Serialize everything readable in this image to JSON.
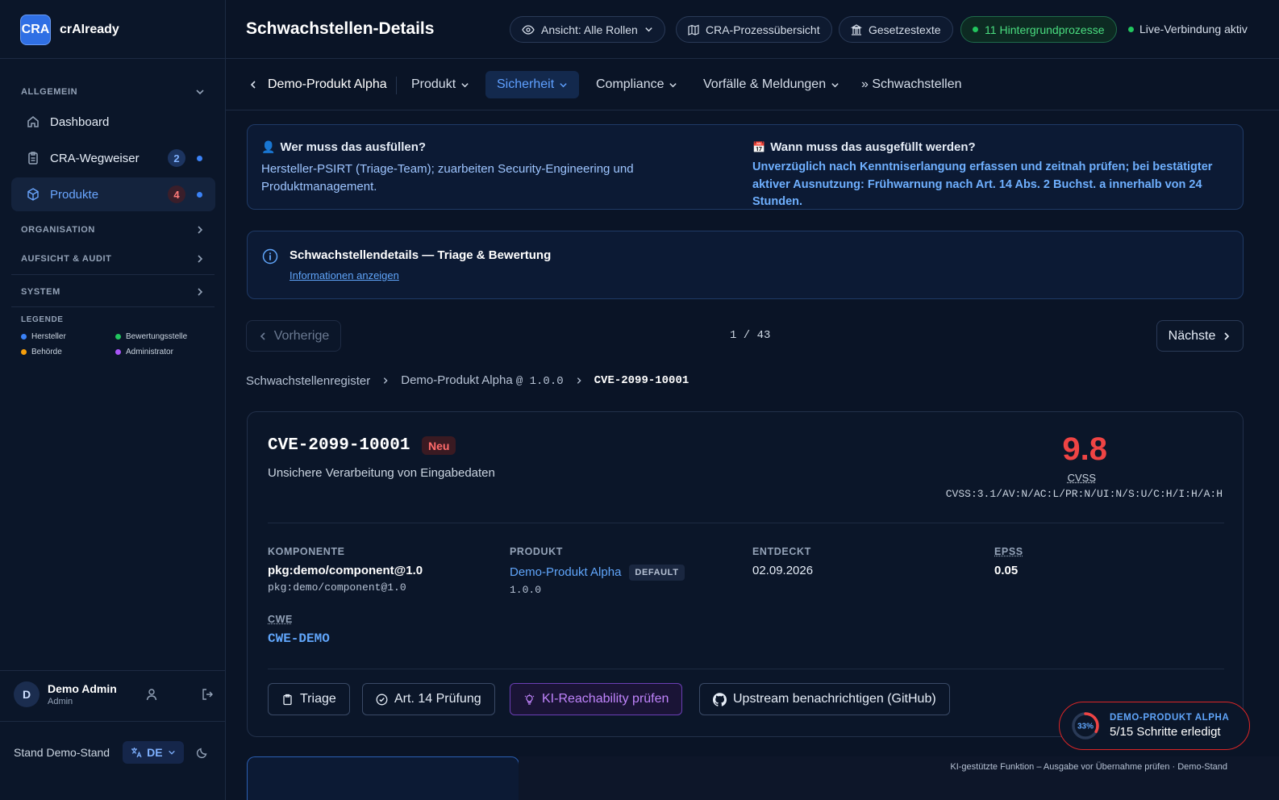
{
  "brand": {
    "logo": "CRA",
    "name": "crAIready"
  },
  "sidebar": {
    "sections": {
      "allgemein": "ALLGEMEIN",
      "organisation": "ORGANISATION",
      "aufsicht": "AUFSICHT & AUDIT",
      "system": "SYSTEM"
    },
    "items": [
      {
        "label": "Dashboard",
        "icon": "home-icon"
      },
      {
        "label": "CRA-Wegweiser",
        "icon": "clipboard-icon",
        "badge": "2"
      },
      {
        "label": "Produkte",
        "icon": "box-icon",
        "badge": "4"
      }
    ],
    "legend": {
      "title": "LEGENDE",
      "entries": [
        {
          "label": "Hersteller",
          "color": "#3b82f6"
        },
        {
          "label": "Bewertungsstelle",
          "color": "#22c55e"
        },
        {
          "label": "Behörde",
          "color": "#f59e0b"
        },
        {
          "label": "Administrator",
          "color": "#a855f7"
        }
      ]
    },
    "user": {
      "initial": "D",
      "name": "Demo Admin",
      "role": "Admin"
    },
    "footer": {
      "status": "Stand Demo-Stand",
      "lang": "DE"
    }
  },
  "header": {
    "title": "Schwachstellen-Details",
    "view_pill": "Ansicht: Alle Rollen",
    "process_pill": "CRA-Prozessübersicht",
    "law_pill": "Gesetzestexte",
    "bg_count": "11",
    "bg_label": "Hintergrundprozesse",
    "live": "Live-Verbindung aktiv"
  },
  "subnav": {
    "product": "Demo-Produkt Alpha",
    "tabs": [
      "Produkt",
      "Sicherheit",
      "Compliance",
      "Vorfälle & Meldungen"
    ],
    "crumb": "» Schwachstellen"
  },
  "who": {
    "title": "Wer muss das ausfüllen?",
    "text": "Hersteller-PSIRT (Triage-Team); zuarbeiten Security-Engineering und Produktmanagement."
  },
  "when": {
    "title": "Wann muss das ausgefüllt werden?",
    "text": "Unverzüglich nach Kenntniserlangung erfassen und zeitnah prüfen; bei bestätigter aktiver Ausnutzung: Frühwarnung nach Art. 14 Abs. 2 Buchst. a innerhalb von 24 Stunden."
  },
  "info": {
    "title": "Schwachstellendetails — Triage & Bewertung",
    "link": "Informationen anzeigen"
  },
  "pager": {
    "prev": "Vorherige",
    "position": "1 / 43",
    "next": "Nächste"
  },
  "breadcrumb": {
    "root": "Schwachstellenregister",
    "product": "Demo-Produkt Alpha",
    "version": "@ 1.0.0",
    "current": "CVE-2099-10001"
  },
  "vuln": {
    "id": "CVE-2099-10001",
    "status": "Neu",
    "description": "Unsichere Verarbeitung von Eingabedaten",
    "score": "9.8",
    "score_label": "CVSS",
    "vector": "CVSS:3.1/AV:N/AC:L/PR:N/UI:N/S:U/C:H/I:H/A:H",
    "fields": {
      "component_label": "KOMPONENTE",
      "component": "pkg:demo/component@1.0",
      "component_sub": "pkg:demo/component@1.0",
      "product_label": "PRODUKT",
      "product": "Demo-Produkt Alpha",
      "product_tag": "DEFAULT",
      "product_version": "1.0.0",
      "found_label": "ENTDECKT",
      "found": "02.09.2026",
      "epss_label": "EPSS",
      "epss": "0.05",
      "cwe_label": "CWE",
      "cwe": "CWE-DEMO"
    },
    "actions": {
      "triage": "Triage",
      "art14": "Art. 14 Prüfung",
      "ki": "KI-Reachability prüfen",
      "upstream": "Upstream benachrichtigen (GitHub)"
    }
  },
  "progress": {
    "percent": 33,
    "percent_label": "33%",
    "title": "DEMO-PRODUKT ALPHA",
    "steps": "5/15 Schritte erledigt"
  },
  "footer_note": "KI-gestützte Funktion – Ausgabe vor Übernahme prüfen · Demo-Stand",
  "colors": {
    "accent": "#3b82f6",
    "danger": "#ef4444",
    "success": "#22c55e",
    "ki": "#c084fc"
  }
}
